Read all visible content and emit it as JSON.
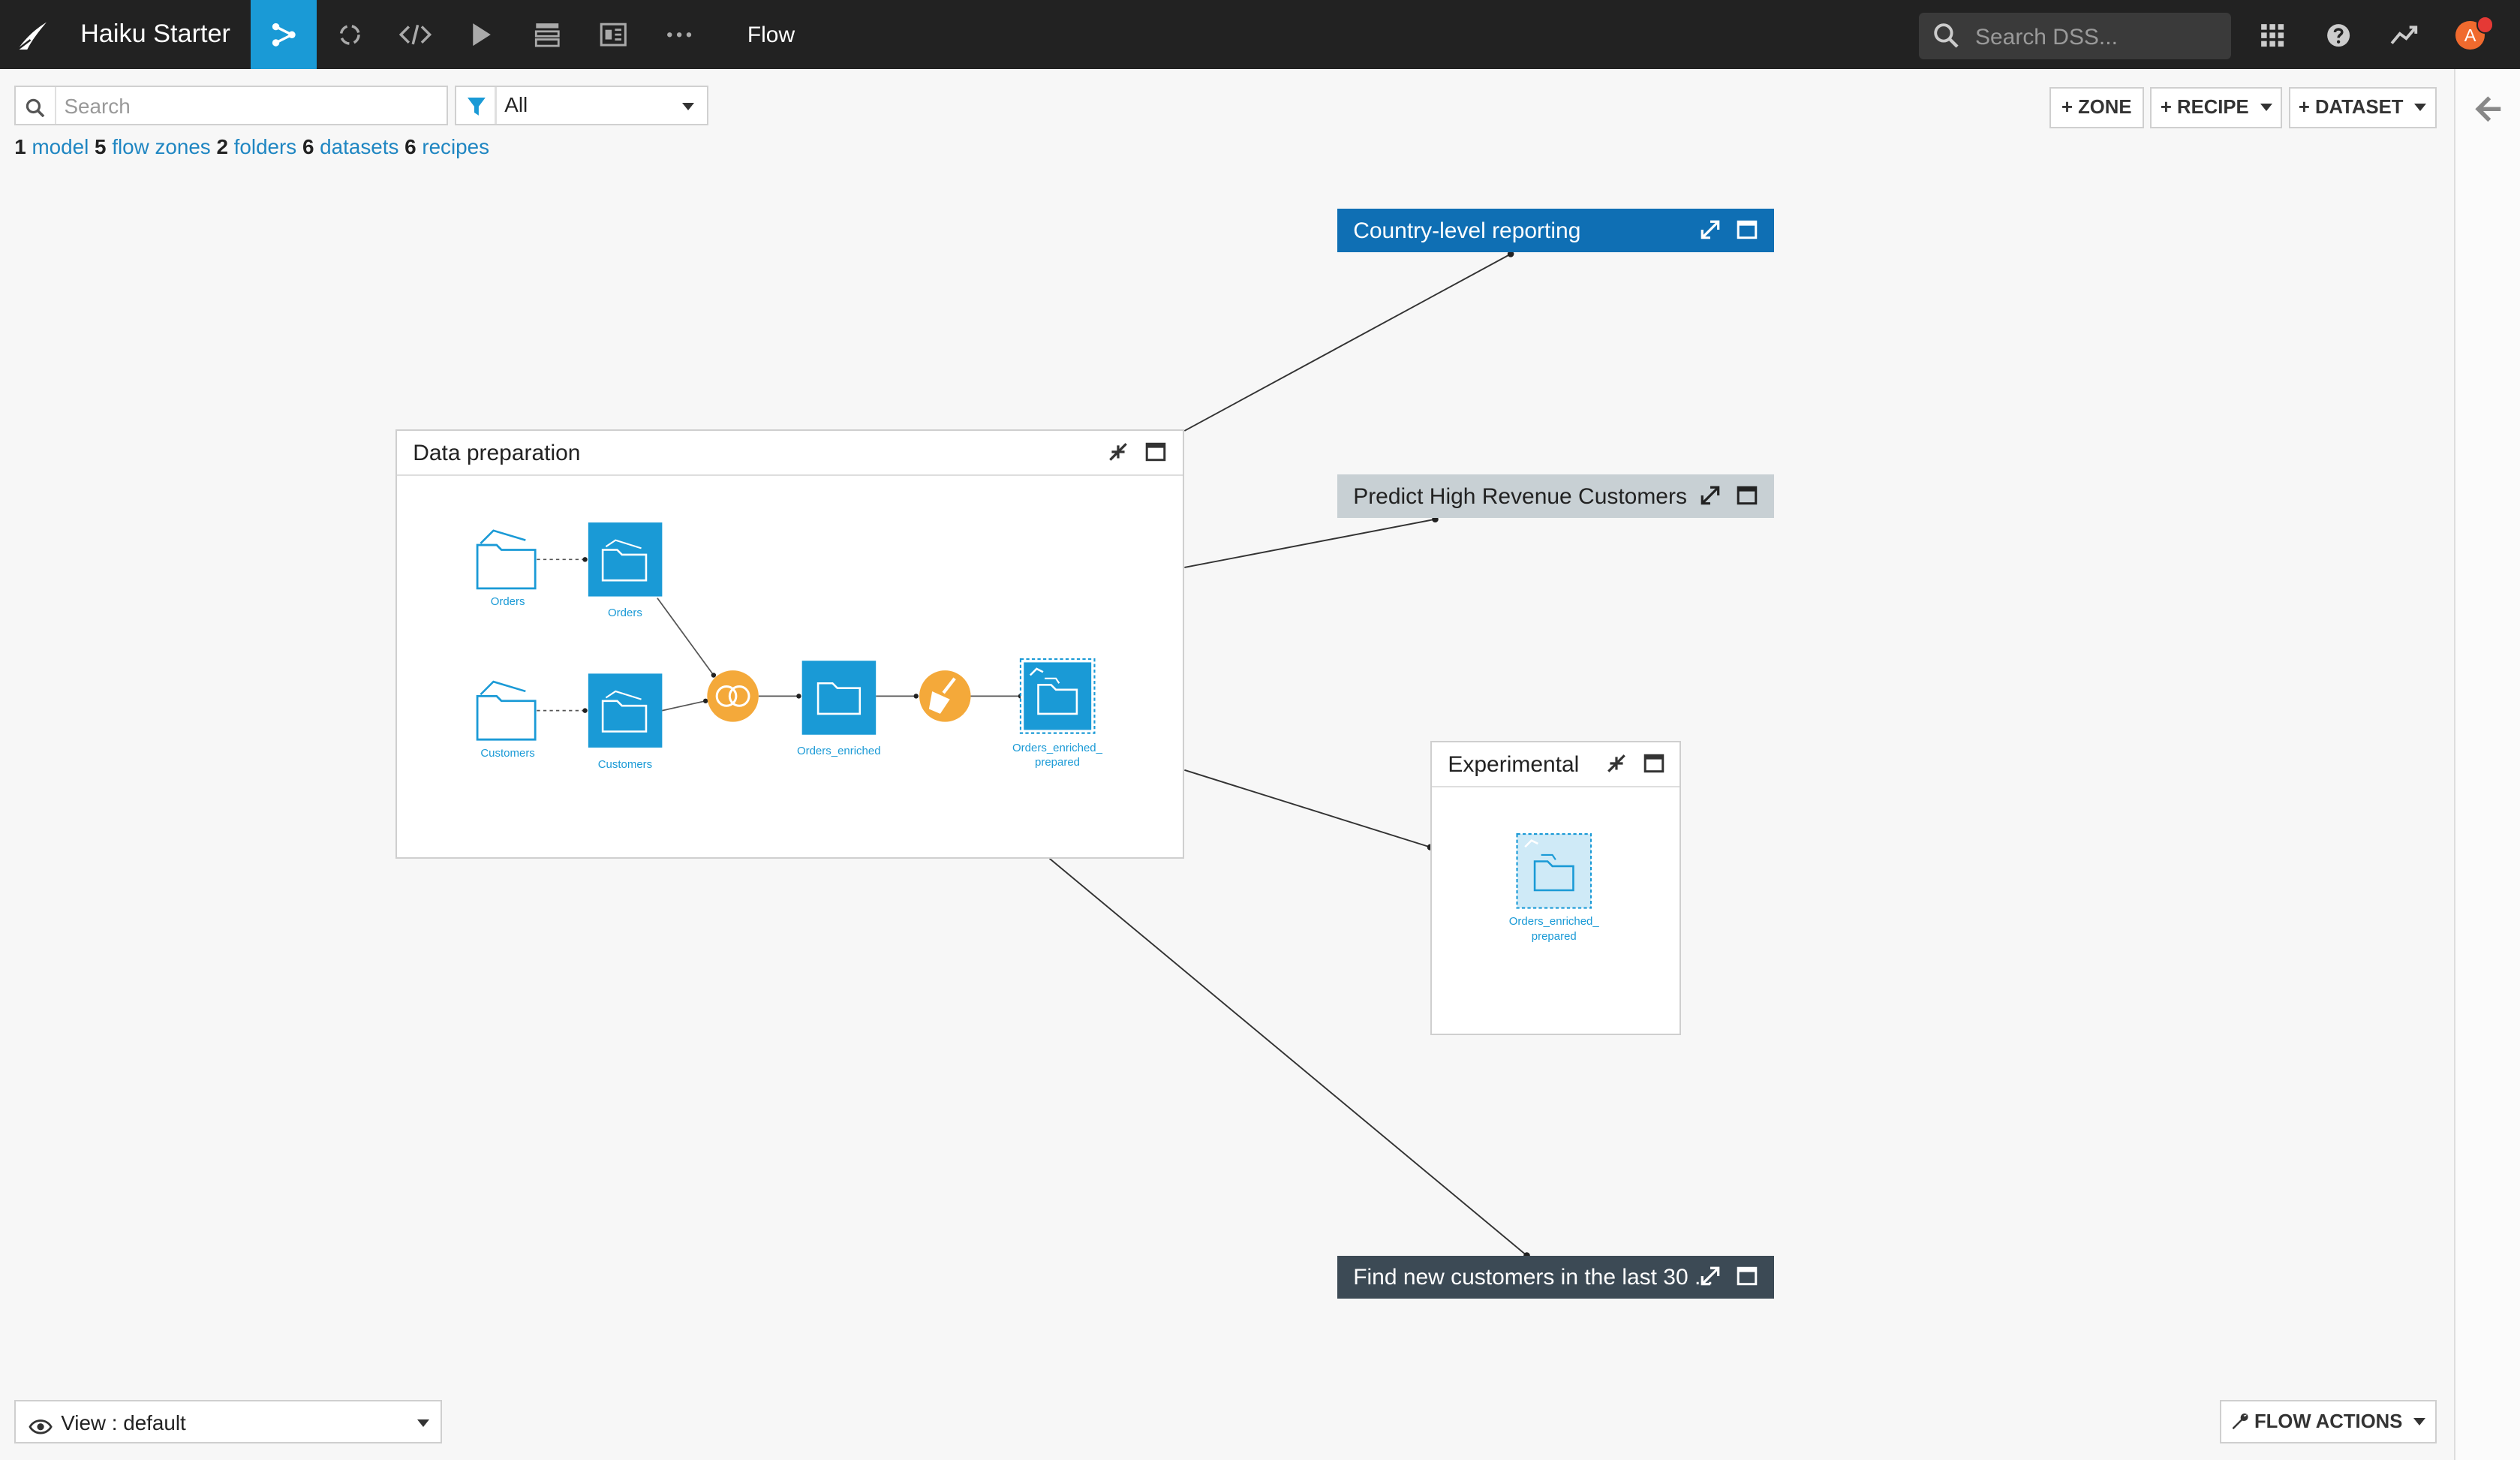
{
  "app": {
    "project_title": "Haiku Starter",
    "current_section": "Flow",
    "global_search_placeholder": "Search DSS...",
    "avatar_initial": "A",
    "accent_color": "#1a9ad6",
    "nav_icons": [
      "flow-icon",
      "lab-icon",
      "code-icon",
      "run-icon",
      "deploy-icon",
      "dashboard-icon",
      "more-icon"
    ],
    "top_right_icons": [
      "apps-grid-icon",
      "help-icon",
      "activity-icon"
    ]
  },
  "toolbar": {
    "search_placeholder": "Search",
    "filter_value": "All",
    "zone_label": "+ ZONE",
    "recipe_label": "+ RECIPE",
    "dataset_label": "+ DATASET"
  },
  "summary": {
    "model_count": "1",
    "model_label": "model",
    "zone_count": "5",
    "zone_label": "flow zones",
    "folder_count": "2",
    "folder_label": "folders",
    "dataset_count": "6",
    "dataset_label": "datasets",
    "recipe_count": "6",
    "recipe_label": "recipes"
  },
  "zones": {
    "country": {
      "title": "Country-level reporting",
      "color": "#0f6fb4"
    },
    "predict": {
      "title": "Predict High Revenue Customers",
      "color": "#c8d0d4"
    },
    "data_prep": {
      "title": "Data preparation"
    },
    "experimental": {
      "title": "Experimental"
    },
    "find_new": {
      "title": "Find new customers in the last 30 ...",
      "color": "#3c4a55"
    }
  },
  "nodes": {
    "orders_source": "Orders",
    "orders_dataset": "Orders",
    "customers_source": "Customers",
    "customers_dataset": "Customers",
    "orders_enriched": "Orders_enriched",
    "orders_enriched_prepared": [
      "Orders_enriched_",
      "prepared"
    ],
    "exp_orders_enriched_prepared": [
      "Orders_enriched_",
      "prepared"
    ]
  },
  "bottom": {
    "view_label": "View : default",
    "flow_actions_label": "FLOW ACTIONS"
  }
}
